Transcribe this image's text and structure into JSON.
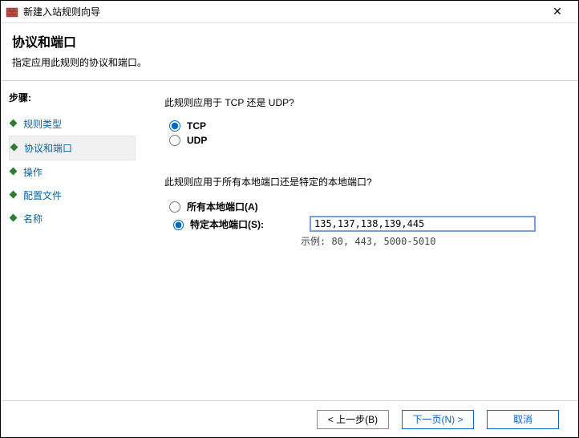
{
  "window": {
    "title": "新建入站规则向导",
    "close_glyph": "✕"
  },
  "header": {
    "title": "协议和端口",
    "subtitle": "指定应用此规则的协议和端口。"
  },
  "sidebar": {
    "steps_label": "步骤:",
    "items": [
      {
        "label": "规则类型",
        "active": false
      },
      {
        "label": "协议和端口",
        "active": true
      },
      {
        "label": "操作",
        "active": false
      },
      {
        "label": "配置文件",
        "active": false
      },
      {
        "label": "名称",
        "active": false
      }
    ]
  },
  "main": {
    "question1": "此规则应用于 TCP 还是 UDP?",
    "protocol": {
      "tcp_label": "TCP",
      "udp_label": "UDP",
      "selected": "tcp"
    },
    "question2": "此规则应用于所有本地端口还是特定的本地端口?",
    "ports": {
      "all_label": "所有本地端口(A)",
      "specific_label": "特定本地端口(S):",
      "selected": "specific",
      "value": "135,137,138,139,445",
      "example": "示例: 80, 443, 5000-5010"
    }
  },
  "footer": {
    "back": "< 上一步(B)",
    "next": "下一页(N) >",
    "cancel": "取消"
  }
}
